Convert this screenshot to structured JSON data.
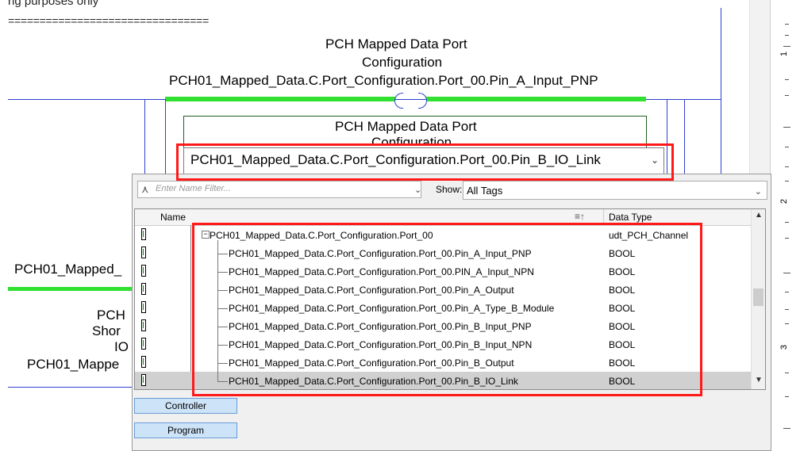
{
  "rung": {
    "comment_partial": "ng purposes only",
    "comment_rule": "================================",
    "top_instruction": {
      "title_line1": "PCH Mapped Data Port",
      "title_line2": "Configuration",
      "tag": "PCH01_Mapped_Data.C.Port_Configuration.Port_00.Pin_A_Input_PNP"
    },
    "editing_instruction": {
      "title_line1": "PCH Mapped Data Port",
      "title_line2": "Configuration"
    },
    "left_labels": [
      "PCH01_Mapped_",
      "PCH",
      "Shor",
      "IO",
      "PCH01_Mappe"
    ]
  },
  "tag_combo": {
    "value": "PCH01_Mapped_Data.C.Port_Configuration.Port_00.Pin_B_IO_Link",
    "arrow_icon": "chevron-down-icon"
  },
  "browser": {
    "filter_placeholder": "Enter Name Filter...",
    "show_label": "Show:",
    "show_value": "All Tags",
    "columns": {
      "name": "Name",
      "data_type": "Data Type"
    },
    "rows": [
      {
        "name": "PCH01_Mapped_Data.C.Port_Configuration.Port_00",
        "type": "udt_PCH_Channel",
        "parent": true
      },
      {
        "name": "PCH01_Mapped_Data.C.Port_Configuration.Port_00.Pin_A_Input_PNP",
        "type": "BOOL"
      },
      {
        "name": "PCH01_Mapped_Data.C.Port_Configuration.Port_00.PIN_A_Input_NPN",
        "type": "BOOL"
      },
      {
        "name": "PCH01_Mapped_Data.C.Port_Configuration.Port_00.Pin_A_Output",
        "type": "BOOL"
      },
      {
        "name": "PCH01_Mapped_Data.C.Port_Configuration.Port_00.Pin_A_Type_B_Module",
        "type": "BOOL"
      },
      {
        "name": "PCH01_Mapped_Data.C.Port_Configuration.Port_00.Pin_B_Input_PNP",
        "type": "BOOL"
      },
      {
        "name": "PCH01_Mapped_Data.C.Port_Configuration.Port_00.Pin_B_Input_NPN",
        "type": "BOOL"
      },
      {
        "name": "PCH01_Mapped_Data.C.Port_Configuration.Port_00.Pin_B_Output",
        "type": "BOOL"
      },
      {
        "name": "PCH01_Mapped_Data.C.Port_Configuration.Port_00.Pin_B_IO_Link",
        "type": "BOOL",
        "selected": true
      }
    ],
    "buttons": {
      "controller": "Controller",
      "program": "Program"
    }
  },
  "ruler": {
    "numbers": [
      "1",
      "2",
      "3"
    ]
  },
  "colors": {
    "highlight": "#ff1a1a",
    "rung_wire": "#2f3fcf",
    "energized": "#32e032"
  }
}
